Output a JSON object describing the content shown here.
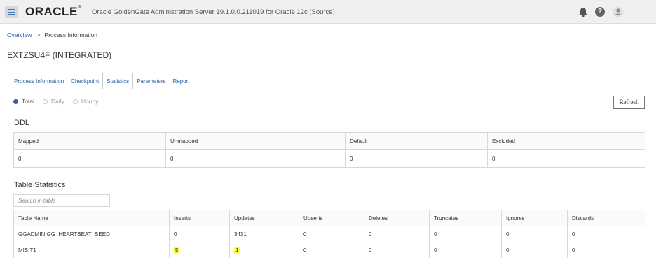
{
  "header": {
    "logo": "ORACLE",
    "logo_mark": "®",
    "title": "Oracle GoldenGate Administration Server 19.1.0.0.211019 for Oracle 12c (Source)",
    "icons": [
      "hamburger-menu-icon",
      "bell-icon",
      "help-icon",
      "user-icon"
    ]
  },
  "breadcrumb": {
    "overview": "Overview",
    "separator": ">",
    "current": "Process Information"
  },
  "page": {
    "title": "EXTZSU4F (INTEGRATED)"
  },
  "tabs": [
    {
      "label": "Process Information",
      "active": false
    },
    {
      "label": "Checkpoint",
      "active": false
    },
    {
      "label": "Statistics",
      "active": true
    },
    {
      "label": "Parameters",
      "active": false
    },
    {
      "label": "Report",
      "active": false
    }
  ],
  "filter": {
    "options": [
      {
        "label": "Total",
        "selected": true
      },
      {
        "label": "Daily",
        "selected": false
      },
      {
        "label": "Hourly",
        "selected": false
      }
    ],
    "refresh_label": "Refresh"
  },
  "ddl": {
    "title": "DDL",
    "columns": [
      "Mapped",
      "Unmapped",
      "Default",
      "Excluded"
    ],
    "values": [
      "0",
      "0",
      "0",
      "0"
    ]
  },
  "table_statistics": {
    "title": "Table Statistics",
    "search_placeholder": "Search in table",
    "columns": [
      "Table Name",
      "Inserts",
      "Updates",
      "Upserts",
      "Deletes",
      "Truncates",
      "Ignores",
      "Discards"
    ],
    "rows": [
      [
        "GGADMIN.GG_HEARTBEAT_SEED",
        "0",
        "3431",
        "0",
        "0",
        "0",
        "0",
        "0"
      ],
      [
        "MIS.T1",
        "5",
        "1",
        "0",
        "0",
        "0",
        "0",
        "0"
      ]
    ],
    "highlight_color": "#ffff33"
  },
  "colors": {
    "accent": "#2a62a5",
    "topbar": "#f0f0f0"
  }
}
